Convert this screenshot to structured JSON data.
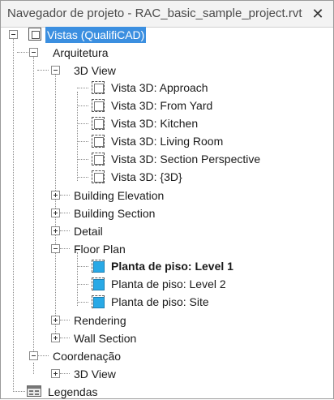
{
  "window": {
    "title": "Navegador de projeto - RAC_basic_sample_project.rvt",
    "close_glyph": "✕"
  },
  "tree": {
    "root": {
      "label": "Vistas (QualifiCAD)",
      "selected": true,
      "icon": "view-set-icon"
    },
    "arquitetura": {
      "label": "Arquitetura",
      "view3d": {
        "label": "3D View",
        "items": [
          "Vista 3D: Approach",
          "Vista 3D: From Yard",
          "Vista 3D: Kitchen",
          "Vista 3D: Living Room",
          "Vista 3D: Section Perspective",
          "Vista 3D: {3D}"
        ]
      },
      "building_elevation": "Building Elevation",
      "building_section": "Building Section",
      "detail": "Detail",
      "floor_plan": {
        "label": "Floor Plan",
        "items": [
          {
            "label": "Planta de piso: Level 1",
            "bold": true
          },
          {
            "label": "Planta de piso: Level 2",
            "bold": false
          },
          {
            "label": "Planta de piso: Site",
            "bold": false
          }
        ]
      },
      "rendering": "Rendering",
      "wall_section": "Wall Section"
    },
    "coordenacao": {
      "label": "Coordenação",
      "view3d": "3D View"
    },
    "legendas": "Legendas"
  },
  "colors": {
    "selection": "#3b8fe0",
    "plan_icon": "#29a9e6"
  }
}
